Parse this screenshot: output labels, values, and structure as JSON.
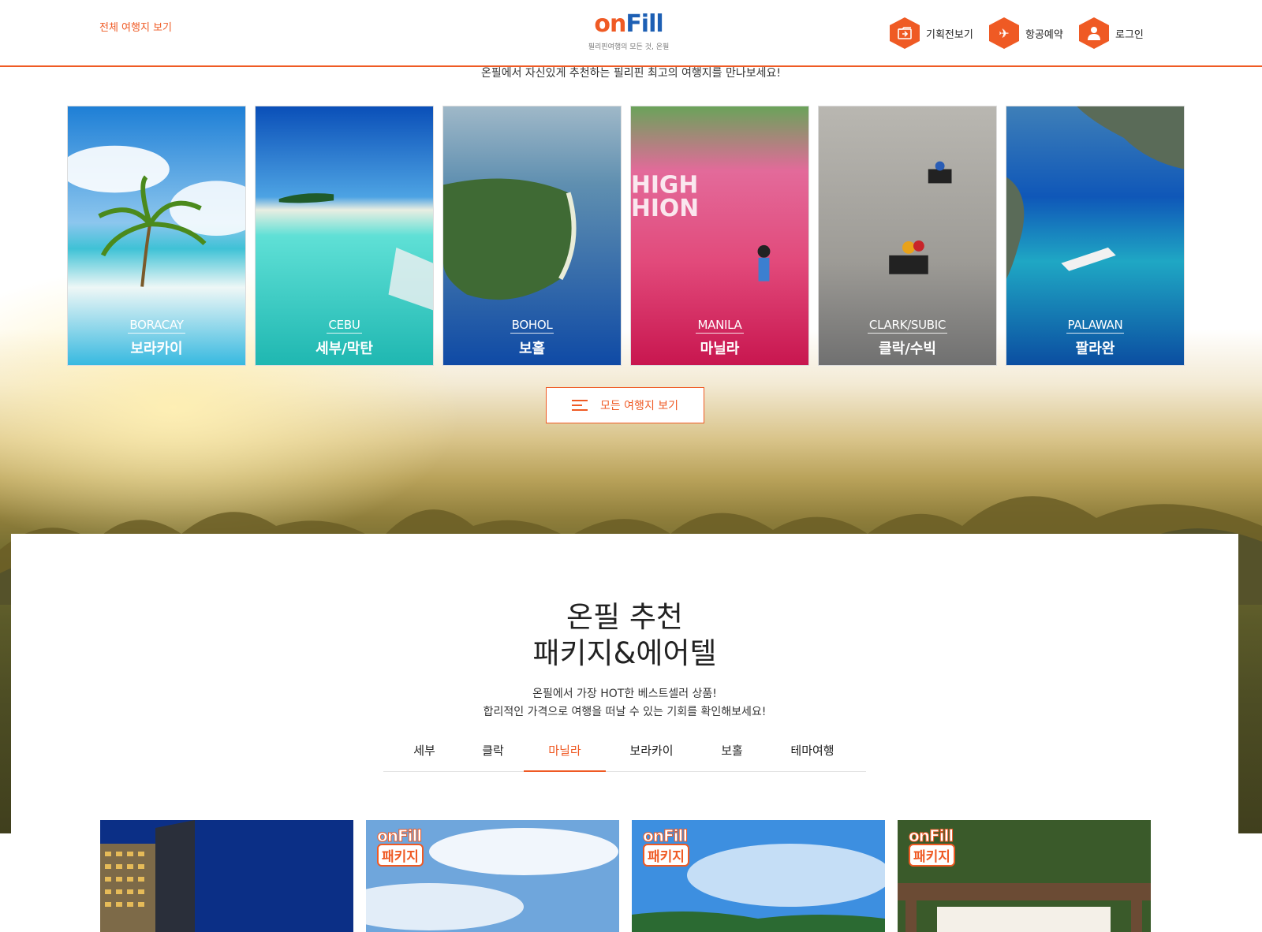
{
  "header": {
    "all_destinations": "전체 여행지 보기",
    "logo": {
      "on": "on",
      "fill": "Fill",
      "tagline": "필리핀여행의 모든 것, 온필"
    },
    "nav": [
      {
        "label": "기획전보기",
        "icon": "plan-folder-icon"
      },
      {
        "label": "항공예약",
        "icon": "airplane-icon"
      },
      {
        "label": "로그인",
        "icon": "user-icon"
      }
    ]
  },
  "intro": "온필에서 자신있게 추천하는 필리핀 최고의 여행지를 만나보세요!",
  "destinations": [
    {
      "en": "BORACAY",
      "ko": "보라카이"
    },
    {
      "en": "CEBU",
      "ko": "세부/막탄"
    },
    {
      "en": "BOHOL",
      "ko": "보홀"
    },
    {
      "en": "MANILA",
      "ko": "마닐라"
    },
    {
      "en": "CLARK/SUBIC",
      "ko": "클락/수빅"
    },
    {
      "en": "PALAWAN",
      "ko": "팔라완"
    }
  ],
  "all_button": "모든 여행지 보기",
  "recommend": {
    "title_line1": "온필 추천",
    "title_line2": "패키지&에어텔",
    "desc_line1": "온필에서 가장 HOT한 베스트셀러 상품!",
    "desc_line2": "합리적인 가격으로 여행을 떠날 수 있는 기회를 확인해보세요!",
    "tabs": [
      "세부",
      "클락",
      "마닐라",
      "보라카이",
      "보홀",
      "테마여행"
    ],
    "active_tab": "마닐라"
  },
  "products": [
    {
      "badge": false
    },
    {
      "badge": true,
      "badge_logo": "onFill",
      "badge_label": "패키지"
    },
    {
      "badge": true,
      "badge_logo": "onFill",
      "badge_label": "패키지"
    },
    {
      "badge": true,
      "badge_logo": "onFill",
      "badge_label": "패키지"
    }
  ],
  "colors": {
    "accent": "#ef5a24",
    "logo_blue": "#1d5fb4"
  }
}
